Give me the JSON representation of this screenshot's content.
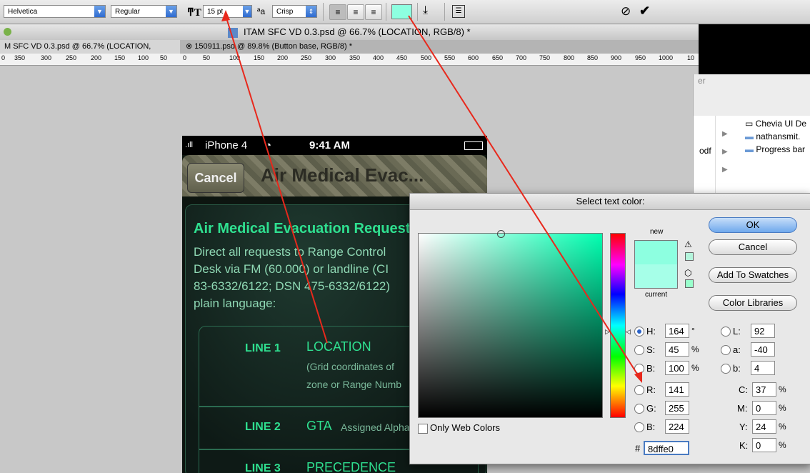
{
  "options_bar": {
    "font_family": "Helvetica",
    "font_style": "Regular",
    "font_size": "15 pt",
    "antialias": "Crisp",
    "text_color_swatch": "#8dffe0",
    "icons": [
      "text-size-icon",
      "antialias-icon",
      "align-left-icon",
      "align-center-icon",
      "align-right-icon",
      "warp-text-icon",
      "character-panel-icon",
      "cancel-icon",
      "commit-icon"
    ]
  },
  "document": {
    "title": "ITAM SFC VD 0.3.psd @ 66.7% (LOCATION, RGB/8) *",
    "tabs": [
      {
        "label": "M SFC VD 0.3.psd @ 66.7% (LOCATION, RGB/8) *"
      },
      {
        "label": "150911.psd @ 89.8% (Button base, RGB/8) *"
      }
    ],
    "ruler_labels": [
      "0",
      "350",
      "300",
      "250",
      "200",
      "150",
      "100",
      "50",
      "0",
      "50",
      "100",
      "150",
      "200",
      "250",
      "300",
      "350",
      "400",
      "450",
      "500",
      "550",
      "600",
      "650",
      "700",
      "750",
      "800",
      "850",
      "900",
      "950",
      "1000",
      "10"
    ]
  },
  "file_panel": {
    "fragments": [
      "er",
      "odf"
    ],
    "items": [
      "Chevia UI De",
      "nathansmit.",
      "Progress bar"
    ]
  },
  "phone": {
    "carrier": "iPhone 4",
    "time": "9:41 AM",
    "cancel": "Cancel",
    "nav_title": "Air Medical Evac...",
    "heading": "Air Medical Evacuation Request",
    "body_lines": [
      "Direct all requests to Range Control",
      "Desk via FM (60.000) or landline (CI",
      "83-6332/6122; DSN 475-6332/6122)",
      "plain language:"
    ],
    "rows": [
      {
        "label": "LINE 1",
        "value": "LOCATION",
        "sub1": "(Grid coordinates of",
        "sub2": "zone or Range Numb"
      },
      {
        "label": "LINE 2",
        "value": "GTA",
        "sub1": "Assigned Alpha"
      },
      {
        "label": "LINE 3",
        "value": "PRECEDENCE"
      }
    ]
  },
  "color_picker": {
    "title": "Select text color:",
    "new_label": "new",
    "current_label": "current",
    "new_color": "#8dffe0",
    "current_color": "#a6ffe8",
    "buttons": {
      "ok": "OK",
      "cancel": "Cancel",
      "add_swatches": "Add To Swatches",
      "libraries": "Color Libraries"
    },
    "only_web": "Only Web Colors",
    "hsb": {
      "h_label": "H:",
      "h": "164",
      "h_unit": "°",
      "s_label": "S:",
      "s": "45",
      "s_unit": "%",
      "b_label": "B:",
      "b": "100",
      "b_unit": "%"
    },
    "rgb": {
      "r_label": "R:",
      "r": "141",
      "g_label": "G:",
      "g": "255",
      "b_label": "B:",
      "b": "224"
    },
    "lab": {
      "l_label": "L:",
      "l": "92",
      "a_label": "a:",
      "a": "-40",
      "b_label": "b:",
      "b": "4"
    },
    "cmyk": {
      "c_label": "C:",
      "c": "37",
      "m_label": "M:",
      "m": "0",
      "y_label": "Y:",
      "y": "24",
      "k_label": "K:",
      "k": "0",
      "unit": "%"
    },
    "hex_label": "#",
    "hex": "8dffe0"
  }
}
